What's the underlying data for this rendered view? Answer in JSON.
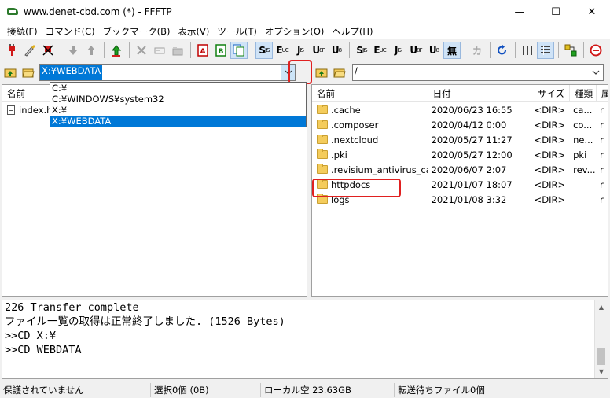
{
  "window": {
    "title": "www.denet-cbd.com (*) - FFFTP",
    "minimize": "—",
    "maximize": "☐",
    "close": "✕"
  },
  "menu": [
    "接続(F)",
    "コマンド(C)",
    "ブックマーク(B)",
    "表示(V)",
    "ツール(T)",
    "オプション(O)",
    "ヘルプ(H)"
  ],
  "toolbar": {
    "code_buttons": [
      {
        "main": "S",
        "sub": "JIS"
      },
      {
        "main": "E",
        "sub": "UC"
      },
      {
        "main": "J",
        "sub": "IS"
      },
      {
        "main": "U",
        "sub": "8F"
      },
      {
        "main": "U",
        "sub": "8"
      }
    ],
    "muhenkan": "無",
    "kana": "カ"
  },
  "local": {
    "path": "X:¥WEBDATA",
    "dropdown": [
      "C:¥",
      "C:¥WINDOWS¥system32",
      "X:¥",
      "X:¥WEBDATA"
    ],
    "selected_index": 3,
    "columns": {
      "name": "名前"
    },
    "files": [
      {
        "name": "index.html"
      }
    ]
  },
  "remote": {
    "path": "/",
    "columns": {
      "name": "名前",
      "date": "日付",
      "size": "サイズ",
      "type": "種類",
      "attr": "属"
    },
    "files": [
      {
        "name": ".cache",
        "date": "2020/06/23 16:55",
        "size": "<DIR>",
        "type": "ca...",
        "attr": "r"
      },
      {
        "name": ".composer",
        "date": "2020/04/12 0:00",
        "size": "<DIR>",
        "type": "co...",
        "attr": "r"
      },
      {
        "name": ".nextcloud",
        "date": "2020/05/27 11:27",
        "size": "<DIR>",
        "type": "ne...",
        "attr": "r"
      },
      {
        "name": ".pki",
        "date": "2020/05/27 12:00",
        "size": "<DIR>",
        "type": "pki",
        "attr": "r"
      },
      {
        "name": ".revisium_antivirus_ca...",
        "date": "2020/06/07 2:07",
        "size": "<DIR>",
        "type": "rev...",
        "attr": "r"
      },
      {
        "name": "httpdocs",
        "date": "2021/01/07 18:07",
        "size": "<DIR>",
        "type": "",
        "attr": "r"
      },
      {
        "name": "logs",
        "date": "2021/01/08 3:32",
        "size": "<DIR>",
        "type": "",
        "attr": "r"
      }
    ]
  },
  "log": [
    "226 Transfer complete",
    "ファイル一覧の取得は正常終了しました. (1526 Bytes)",
    ">>CD X:¥",
    ">>CD WEBDATA"
  ],
  "status": {
    "security": "保護されていません",
    "selection": "選択0個 (0B)",
    "local_free": "ローカル空 23.63GB",
    "queue": "転送待ちファイル0個"
  },
  "colors": {
    "accent": "#0078d7",
    "highlight_box": "#e02020",
    "folder": "#f4cc5c"
  }
}
